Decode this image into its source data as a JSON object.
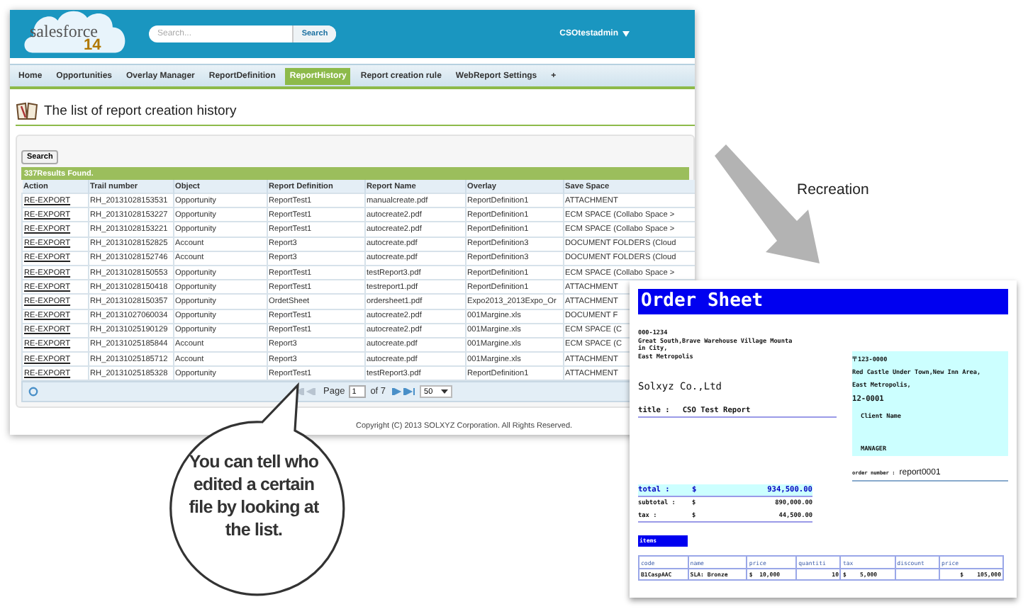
{
  "app": {
    "logo": "salesforce",
    "logo_version": "14",
    "search": {
      "placeholder": "Search...",
      "button": "Search"
    },
    "user": "CSOtestadmin"
  },
  "tabs": [
    {
      "label": "Home",
      "selected": false
    },
    {
      "label": "Opportunities",
      "selected": false
    },
    {
      "label": "Overlay Manager",
      "selected": false
    },
    {
      "label": "ReportDefinition",
      "selected": false
    },
    {
      "label": "ReportHistory",
      "selected": true
    },
    {
      "label": "Report creation rule",
      "selected": false
    },
    {
      "label": "WebReport Settings",
      "selected": false
    },
    {
      "label": "+",
      "selected": false
    }
  ],
  "page": {
    "title": "The list of report creation history",
    "search_button": "Search",
    "results": "337Results Found.",
    "table": {
      "columns": [
        "Action",
        "Trail number",
        "Object",
        "Report Definition",
        "Report Name",
        "Overlay",
        "Save Space"
      ],
      "rows": [
        [
          "RE-EXPORT",
          "RH_20131028153531",
          "Opportunity",
          "ReportTest1",
          "manualcreate.pdf",
          "ReportDefinition1",
          "ATTACHMENT"
        ],
        [
          "RE-EXPORT",
          "RH_20131028153227",
          "Opportunity",
          "ReportTest1",
          "autocreate2.pdf",
          "ReportDefinition1",
          "ECM SPACE (Collabo Space >"
        ],
        [
          "RE-EXPORT",
          "RH_20131028153221",
          "Opportunity",
          "ReportTest1",
          "autocreate2.pdf",
          "ReportDefinition1",
          "ECM SPACE (Collabo Space >"
        ],
        [
          "RE-EXPORT",
          "RH_20131028152825",
          "Account",
          "Report3",
          "autocreate.pdf",
          "ReportDefinition3",
          "DOCUMENT FOLDERS (Cloud"
        ],
        [
          "RE-EXPORT",
          "RH_20131028152746",
          "Account",
          "Report3",
          "autocreate.pdf",
          "ReportDefinition3",
          "DOCUMENT FOLDERS (Cloud"
        ],
        [
          "RE-EXPORT",
          "RH_20131028150553",
          "Opportunity",
          "ReportTest1",
          "testReport3.pdf",
          "ReportDefinition1",
          "ECM SPACE (Collabo Space >"
        ],
        [
          "RE-EXPORT",
          "RH_20131028150418",
          "Opportunity",
          "ReportTest1",
          "testreport1.pdf",
          "ReportDefinition1",
          "ATTACHMENT"
        ],
        [
          "RE-EXPORT",
          "RH_20131028150357",
          "Opportunity",
          "OrdetSheet",
          "ordersheet1.pdf",
          "Expo2013_2013Expo_Or",
          "ATTACHMENT"
        ],
        [
          "RE-EXPORT",
          "RH_20131027060034",
          "Opportunity",
          "ReportTest1",
          "autocreate2.pdf",
          "001Margine.xls",
          "DOCUMENT F"
        ],
        [
          "RE-EXPORT",
          "RH_20131025190129",
          "Opportunity",
          "ReportTest1",
          "autocreate2.pdf",
          "001Margine.xls",
          "ECM SPACE (C"
        ],
        [
          "RE-EXPORT",
          "RH_20131025185844",
          "Account",
          "Report3",
          "autocreate.pdf",
          "001Margine.xls",
          "ECM SPACE (C"
        ],
        [
          "RE-EXPORT",
          "RH_20131025185712",
          "Account",
          "Report3",
          "autocreate.pdf",
          "001Margine.xls",
          "ATTACHMENT"
        ],
        [
          "RE-EXPORT",
          "RH_20131025185328",
          "Opportunity",
          "ReportTest1",
          "testReport3.pdf",
          "ReportDefinition1",
          "ATTACHMENT"
        ]
      ]
    },
    "pager": {
      "page_label": "Page",
      "page": "1",
      "of": "of 7",
      "page_size": "50"
    },
    "footer": "Copyright (C) 2013 SOLXYZ Corporation. All Rights Reserved."
  },
  "annotation": {
    "arrow_label": "Recreation",
    "callout": "You can tell who edited a certain file by looking at the list."
  },
  "order_sheet": {
    "title": "Order Sheet",
    "sender": {
      "postal": "000-1234",
      "lines": [
        "Great South,Brave Warehouse Village Mounta",
        "in City,",
        "East Metropolis"
      ],
      "company": "Solxyz Co.,Ltd"
    },
    "title_label": "title :",
    "title_value": "CSO Test Report",
    "recipient": {
      "postal": "〒123-0000",
      "lines": [
        "Red Castle Under Town,New Inn Area,",
        "East Metropolis,"
      ],
      "code": "12-0001",
      "client": "Client Name",
      "role": "MANAGER"
    },
    "order_number_label": "order number :",
    "order_number": "report0001",
    "totals": [
      {
        "kind": "total",
        "label": "total :",
        "currency": "$",
        "amount": "934,500.00"
      },
      {
        "kind": "line",
        "label": "subtotal :",
        "currency": "$",
        "amount": "890,000.00"
      },
      {
        "kind": "line",
        "label": "tax :",
        "currency": "$",
        "amount": "44,500.00"
      }
    ],
    "items_label": "items",
    "items": {
      "columns": [
        "code",
        "name",
        "price",
        "quantiti",
        "tax",
        "discount",
        "price"
      ],
      "rows": [
        [
          "B1CaspAAC",
          "SLA: Bronze",
          "$  10,000",
          "10",
          "$    5,000",
          "",
          "$    105,000"
        ]
      ]
    }
  }
}
